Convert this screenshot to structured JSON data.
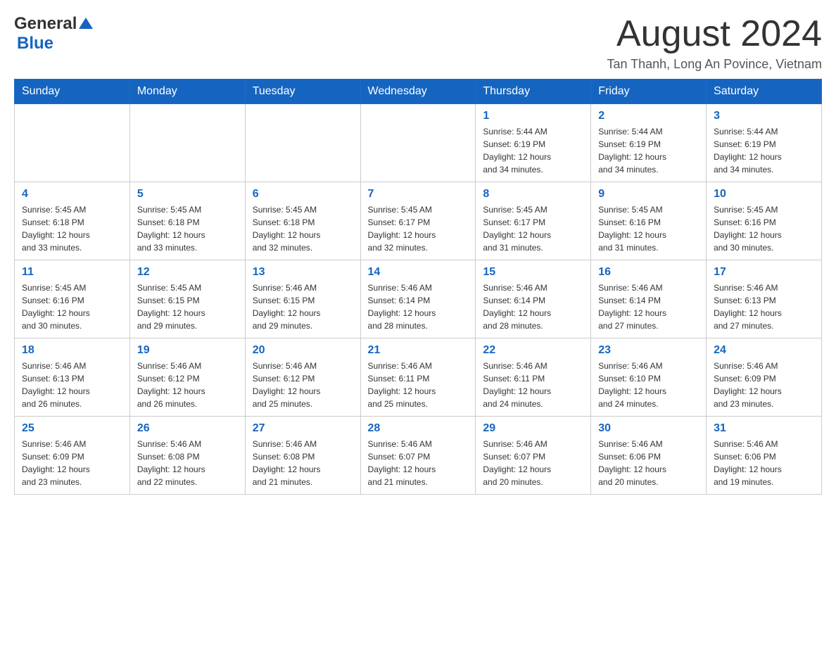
{
  "header": {
    "logo_general": "General",
    "logo_blue": "Blue",
    "month_title": "August 2024",
    "location": "Tan Thanh, Long An Povince, Vietnam"
  },
  "weekdays": [
    "Sunday",
    "Monday",
    "Tuesday",
    "Wednesday",
    "Thursday",
    "Friday",
    "Saturday"
  ],
  "weeks": [
    {
      "days": [
        {
          "number": "",
          "info": ""
        },
        {
          "number": "",
          "info": ""
        },
        {
          "number": "",
          "info": ""
        },
        {
          "number": "",
          "info": ""
        },
        {
          "number": "1",
          "info": "Sunrise: 5:44 AM\nSunset: 6:19 PM\nDaylight: 12 hours\nand 34 minutes."
        },
        {
          "number": "2",
          "info": "Sunrise: 5:44 AM\nSunset: 6:19 PM\nDaylight: 12 hours\nand 34 minutes."
        },
        {
          "number": "3",
          "info": "Sunrise: 5:44 AM\nSunset: 6:19 PM\nDaylight: 12 hours\nand 34 minutes."
        }
      ]
    },
    {
      "days": [
        {
          "number": "4",
          "info": "Sunrise: 5:45 AM\nSunset: 6:18 PM\nDaylight: 12 hours\nand 33 minutes."
        },
        {
          "number": "5",
          "info": "Sunrise: 5:45 AM\nSunset: 6:18 PM\nDaylight: 12 hours\nand 33 minutes."
        },
        {
          "number": "6",
          "info": "Sunrise: 5:45 AM\nSunset: 6:18 PM\nDaylight: 12 hours\nand 32 minutes."
        },
        {
          "number": "7",
          "info": "Sunrise: 5:45 AM\nSunset: 6:17 PM\nDaylight: 12 hours\nand 32 minutes."
        },
        {
          "number": "8",
          "info": "Sunrise: 5:45 AM\nSunset: 6:17 PM\nDaylight: 12 hours\nand 31 minutes."
        },
        {
          "number": "9",
          "info": "Sunrise: 5:45 AM\nSunset: 6:16 PM\nDaylight: 12 hours\nand 31 minutes."
        },
        {
          "number": "10",
          "info": "Sunrise: 5:45 AM\nSunset: 6:16 PM\nDaylight: 12 hours\nand 30 minutes."
        }
      ]
    },
    {
      "days": [
        {
          "number": "11",
          "info": "Sunrise: 5:45 AM\nSunset: 6:16 PM\nDaylight: 12 hours\nand 30 minutes."
        },
        {
          "number": "12",
          "info": "Sunrise: 5:45 AM\nSunset: 6:15 PM\nDaylight: 12 hours\nand 29 minutes."
        },
        {
          "number": "13",
          "info": "Sunrise: 5:46 AM\nSunset: 6:15 PM\nDaylight: 12 hours\nand 29 minutes."
        },
        {
          "number": "14",
          "info": "Sunrise: 5:46 AM\nSunset: 6:14 PM\nDaylight: 12 hours\nand 28 minutes."
        },
        {
          "number": "15",
          "info": "Sunrise: 5:46 AM\nSunset: 6:14 PM\nDaylight: 12 hours\nand 28 minutes."
        },
        {
          "number": "16",
          "info": "Sunrise: 5:46 AM\nSunset: 6:14 PM\nDaylight: 12 hours\nand 27 minutes."
        },
        {
          "number": "17",
          "info": "Sunrise: 5:46 AM\nSunset: 6:13 PM\nDaylight: 12 hours\nand 27 minutes."
        }
      ]
    },
    {
      "days": [
        {
          "number": "18",
          "info": "Sunrise: 5:46 AM\nSunset: 6:13 PM\nDaylight: 12 hours\nand 26 minutes."
        },
        {
          "number": "19",
          "info": "Sunrise: 5:46 AM\nSunset: 6:12 PM\nDaylight: 12 hours\nand 26 minutes."
        },
        {
          "number": "20",
          "info": "Sunrise: 5:46 AM\nSunset: 6:12 PM\nDaylight: 12 hours\nand 25 minutes."
        },
        {
          "number": "21",
          "info": "Sunrise: 5:46 AM\nSunset: 6:11 PM\nDaylight: 12 hours\nand 25 minutes."
        },
        {
          "number": "22",
          "info": "Sunrise: 5:46 AM\nSunset: 6:11 PM\nDaylight: 12 hours\nand 24 minutes."
        },
        {
          "number": "23",
          "info": "Sunrise: 5:46 AM\nSunset: 6:10 PM\nDaylight: 12 hours\nand 24 minutes."
        },
        {
          "number": "24",
          "info": "Sunrise: 5:46 AM\nSunset: 6:09 PM\nDaylight: 12 hours\nand 23 minutes."
        }
      ]
    },
    {
      "days": [
        {
          "number": "25",
          "info": "Sunrise: 5:46 AM\nSunset: 6:09 PM\nDaylight: 12 hours\nand 23 minutes."
        },
        {
          "number": "26",
          "info": "Sunrise: 5:46 AM\nSunset: 6:08 PM\nDaylight: 12 hours\nand 22 minutes."
        },
        {
          "number": "27",
          "info": "Sunrise: 5:46 AM\nSunset: 6:08 PM\nDaylight: 12 hours\nand 21 minutes."
        },
        {
          "number": "28",
          "info": "Sunrise: 5:46 AM\nSunset: 6:07 PM\nDaylight: 12 hours\nand 21 minutes."
        },
        {
          "number": "29",
          "info": "Sunrise: 5:46 AM\nSunset: 6:07 PM\nDaylight: 12 hours\nand 20 minutes."
        },
        {
          "number": "30",
          "info": "Sunrise: 5:46 AM\nSunset: 6:06 PM\nDaylight: 12 hours\nand 20 minutes."
        },
        {
          "number": "31",
          "info": "Sunrise: 5:46 AM\nSunset: 6:06 PM\nDaylight: 12 hours\nand 19 minutes."
        }
      ]
    }
  ]
}
